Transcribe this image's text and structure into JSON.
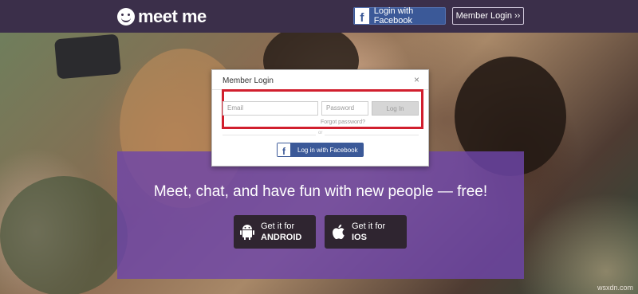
{
  "header": {
    "logo_text": "meet me",
    "facebook_button": "Login with Facebook",
    "member_login_button": "Member Login ››"
  },
  "modal": {
    "title": "Member Login",
    "close": "×",
    "email_placeholder": "Email",
    "password_placeholder": "Password",
    "login_button": "Log In",
    "forgot_password": "Forgot password?",
    "or_label": "or",
    "facebook_button": "Log in with Facebook"
  },
  "promo": {
    "headline": "Meet, chat, and have fun with new people — free!",
    "android": {
      "line1": "Get it for",
      "line2": "ANDROID"
    },
    "ios": {
      "line1": "Get it for",
      "line2": "IOS"
    }
  },
  "colors": {
    "header_bg": "#3b2f4a",
    "facebook_blue": "#3b5998",
    "promo_purple": "#6e46aa",
    "highlight_red": "#d11f2e"
  },
  "watermark": "wsxdn.com"
}
